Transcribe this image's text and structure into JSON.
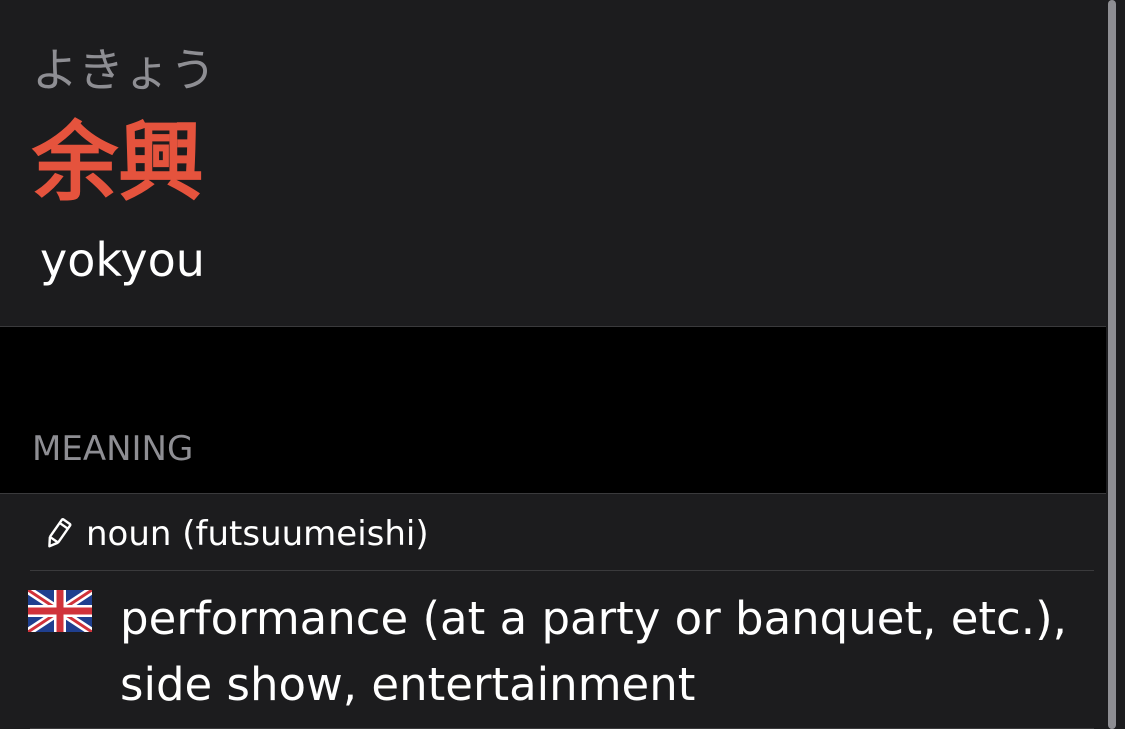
{
  "entry": {
    "reading": "よきょう",
    "kanji": "余興",
    "romaji": "yokyou"
  },
  "meaning_section": {
    "header": "MEANING",
    "part_of_speech": "noun (futsuumeishi)",
    "part_of_speech_icon": "pencil-icon",
    "language_icon": "uk-flag-icon",
    "definition": "performance (at a party or banquet, etc.), side show, entertainment"
  },
  "colors": {
    "kanji_accent": "#e5533d",
    "background_card": "#1c1c1e",
    "background_page": "#000000",
    "secondary_text": "#8e8e93"
  }
}
